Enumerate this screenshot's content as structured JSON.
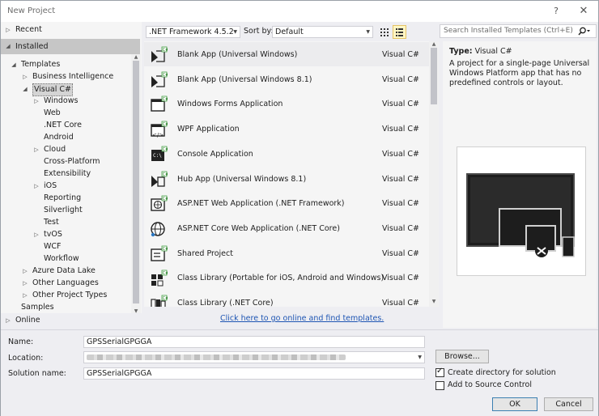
{
  "window": {
    "title": "New Project",
    "help": "?",
    "close": "✕"
  },
  "tree": [
    {
      "label": "Recent",
      "arrow": "▷",
      "level": 0,
      "selected": false
    },
    {
      "label": "Installed",
      "arrow": "◢",
      "level": 0,
      "selected": true
    },
    {
      "label": "Templates",
      "arrow": "◢",
      "level": 1
    },
    {
      "label": "Business Intelligence",
      "arrow": "▷",
      "level": 2
    },
    {
      "label": "Visual C#",
      "arrow": "◢",
      "level": 2,
      "focused": true
    },
    {
      "label": "Windows",
      "arrow": "▷",
      "level": 3
    },
    {
      "label": "Web",
      "arrow": "",
      "level": 3
    },
    {
      "label": ".NET Core",
      "arrow": "",
      "level": 3
    },
    {
      "label": "Android",
      "arrow": "",
      "level": 3
    },
    {
      "label": "Cloud",
      "arrow": "▷",
      "level": 3
    },
    {
      "label": "Cross-Platform",
      "arrow": "",
      "level": 3
    },
    {
      "label": "Extensibility",
      "arrow": "",
      "level": 3
    },
    {
      "label": "iOS",
      "arrow": "▷",
      "level": 3
    },
    {
      "label": "Reporting",
      "arrow": "",
      "level": 3
    },
    {
      "label": "Silverlight",
      "arrow": "",
      "level": 3
    },
    {
      "label": "Test",
      "arrow": "",
      "level": 3
    },
    {
      "label": "tvOS",
      "arrow": "▷",
      "level": 3
    },
    {
      "label": "WCF",
      "arrow": "",
      "level": 3
    },
    {
      "label": "Workflow",
      "arrow": "",
      "level": 3
    },
    {
      "label": "Azure Data Lake",
      "arrow": "▷",
      "level": 2
    },
    {
      "label": "Other Languages",
      "arrow": "▷",
      "level": 2
    },
    {
      "label": "Other Project Types",
      "arrow": "▷",
      "level": 2
    },
    {
      "label": "Samples",
      "arrow": "",
      "level": 1
    }
  ],
  "online": {
    "label": "Online",
    "arrow": "▷"
  },
  "toolbar": {
    "framework": ".NET Framework 4.5.2",
    "sort_label": "Sort by:",
    "sort_value": "Default",
    "search_placeholder": "Search Installed Templates (Ctrl+E)"
  },
  "templates": [
    {
      "name": "Blank App (Universal Windows)",
      "lang": "Visual C#",
      "icon": "uwp-app-icon",
      "selected": true
    },
    {
      "name": "Blank App (Universal Windows 8.1)",
      "lang": "Visual C#",
      "icon": "uwp-app-icon"
    },
    {
      "name": "Windows Forms Application",
      "lang": "Visual C#",
      "icon": "winforms-icon"
    },
    {
      "name": "WPF Application",
      "lang": "Visual C#",
      "icon": "wpf-icon"
    },
    {
      "name": "Console Application",
      "lang": "Visual C#",
      "icon": "console-icon"
    },
    {
      "name": "Hub App (Universal Windows 8.1)",
      "lang": "Visual C#",
      "icon": "hub-app-icon"
    },
    {
      "name": "ASP.NET Web Application (.NET Framework)",
      "lang": "Visual C#",
      "icon": "aspnet-icon"
    },
    {
      "name": "ASP.NET Core Web Application (.NET Core)",
      "lang": "Visual C#",
      "icon": "aspnet-core-icon"
    },
    {
      "name": "Shared Project",
      "lang": "Visual C#",
      "icon": "shared-project-icon"
    },
    {
      "name": "Class Library (Portable for iOS, Android and Windows)",
      "lang": "Visual C#",
      "icon": "portable-library-icon"
    },
    {
      "name": "Class Library (.NET Core)",
      "lang": "Visual C#",
      "icon": "class-library-icon"
    }
  ],
  "online_link": "Click here to go online and find templates.",
  "details": {
    "type_label": "Type:",
    "type_value": "Visual C#",
    "description": "A project for a single-page Universal Windows Platform app that has no predefined controls or layout."
  },
  "form": {
    "name_label": "Name:",
    "name_value": "GPSSerialGPGGA",
    "location_label": "Location:",
    "solution_label": "Solution name:",
    "solution_value": "GPSSerialGPGGA",
    "browse": "Browse...",
    "create_dir_label": "Create directory for solution",
    "create_dir_checked": true,
    "source_control_label": "Add to Source Control",
    "source_control_checked": false,
    "ok": "OK",
    "cancel": "Cancel"
  },
  "colors": {
    "accent": "#1e55b3",
    "selection": "#c6c6c6"
  }
}
